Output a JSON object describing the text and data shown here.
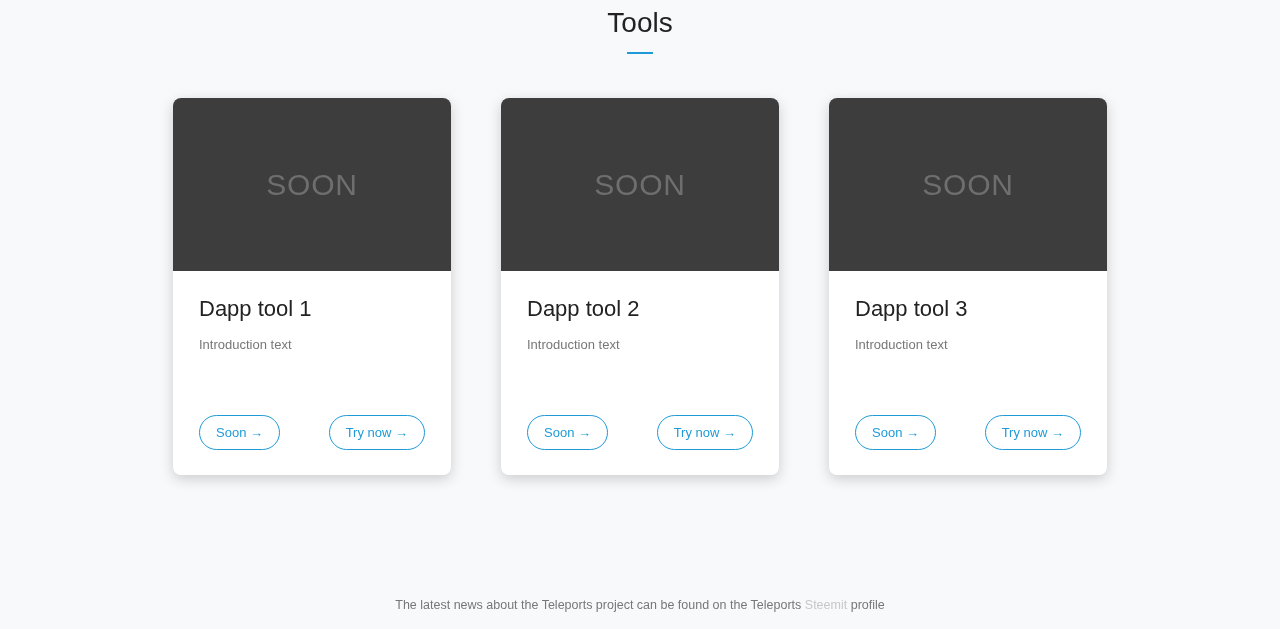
{
  "heading": "Tools",
  "cards": [
    {
      "image_text": "SOON",
      "title": "Dapp tool 1",
      "description": "Introduction text",
      "buttons": [
        "Soon →",
        "Try now →"
      ]
    },
    {
      "image_text": "SOON",
      "title": "Dapp tool 2",
      "description": "Introduction text",
      "buttons": [
        "Soon →",
        "Try now →"
      ]
    },
    {
      "image_text": "SOON",
      "title": "Dapp tool 3",
      "description": "Introduction text",
      "buttons": [
        "Soon →",
        "Try now →"
      ]
    }
  ],
  "footer": {
    "text_before": "The latest news about the Teleports project can be found on the Teleports",
    "link": "Steemit",
    "text_after": "profile"
  }
}
